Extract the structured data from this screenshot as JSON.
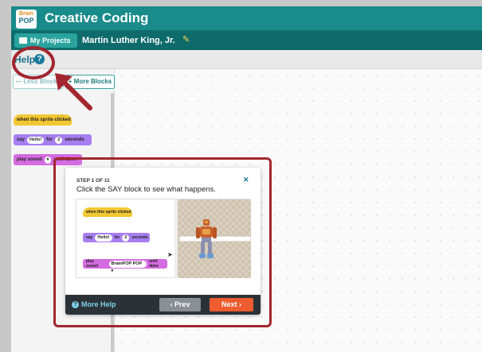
{
  "header": {
    "logo_line1": "Brain",
    "logo_line2": "POP",
    "app_title": "Creative Coding"
  },
  "subbar": {
    "my_projects_label": "My Projects",
    "project_name": "Martin Luther King, Jr."
  },
  "helpbar": {
    "help_label": "Help",
    "help_icon": "question-circle-icon"
  },
  "palette": {
    "less_blocks_label": "‹– Less Blocks",
    "more_blocks_label": "+ More Blocks",
    "blocks": [
      {
        "kind": "event",
        "text": "when this sprite clicked",
        "color": "#f2c832"
      },
      {
        "kind": "looks",
        "text_before": "say",
        "arg1": "Hello!",
        "text_mid": "for",
        "arg2": "2",
        "text_after": "seconds",
        "color": "#a77ef0"
      },
      {
        "kind": "sound",
        "text_before": "play sound",
        "arg1": "▾",
        "text_after": "until done",
        "color": "#d46be0"
      }
    ]
  },
  "dialog": {
    "step_label": "STEP 1 OF 11",
    "step_text": "Click the SAY block to see what happens.",
    "demo_blocks": {
      "hat": "when this sprite clicked",
      "say_before": "say",
      "say_arg1": "Hello!",
      "say_mid": "for",
      "say_arg2": "2",
      "say_after": "seconds",
      "sound_before": "play sound",
      "sound_arg": "BrainPOP POP ▾",
      "sound_after": "until done"
    },
    "more_help_label": "More Help",
    "prev_label": "‹ Prev",
    "next_label": "Next ›"
  },
  "colors": {
    "header_bg": "#1a8b8b",
    "subbar_bg": "#0f6b6b",
    "annotation_red": "#a3262f",
    "next_orange": "#ee5c2f"
  }
}
